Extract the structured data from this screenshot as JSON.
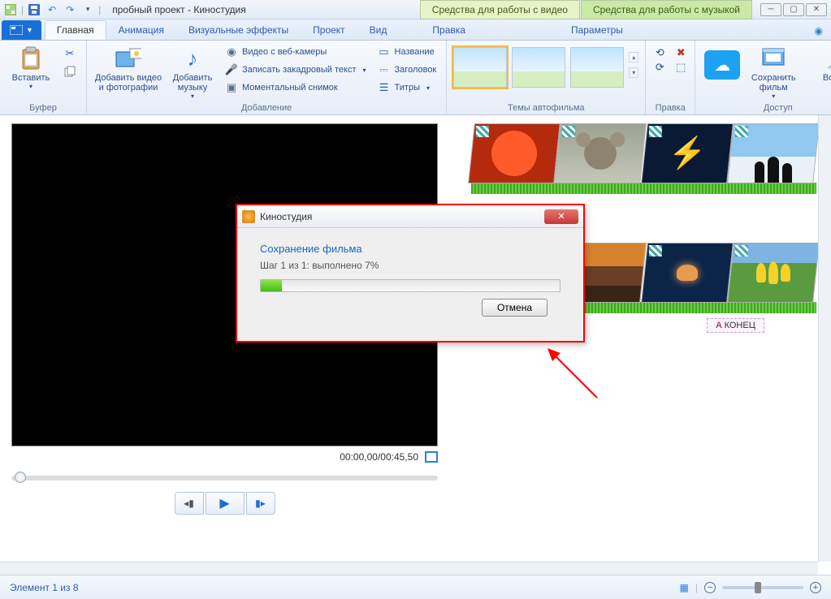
{
  "window": {
    "title": "пробный проект - Киностудия",
    "context_tab_video": "Средства для работы с видео",
    "context_tab_music": "Средства для работы с музыкой"
  },
  "tabs": {
    "file": "⧉",
    "home": "Главная",
    "animation": "Анимация",
    "effects": "Визуальные эффекты",
    "project": "Проект",
    "view": "Вид",
    "edit": "Правка",
    "params": "Параметры"
  },
  "ribbon": {
    "clipboard": {
      "paste": "Вставить",
      "group": "Буфер"
    },
    "add": {
      "video_photo": "Добавить видео и фотографии",
      "music": "Добавить музыку",
      "webcam": "Видео с веб-камеры",
      "narration": "Записать закадровый текст",
      "snapshot": "Моментальный снимок",
      "caption": "Название",
      "heading": "Заголовок",
      "titles": "Титры",
      "group": "Добавление"
    },
    "themes": {
      "group": "Темы автофильма"
    },
    "edit": {
      "group": "Правка"
    },
    "access": {
      "save": "Сохранить фильм",
      "signin": "Войти",
      "group": "Доступ"
    }
  },
  "preview": {
    "timecode": "00:00,00/00:45,50"
  },
  "storyboard": {
    "end_marker": "КОНЕЦ"
  },
  "dialog": {
    "title": "Киностудия",
    "heading": "Сохранение фильма",
    "step": "Шаг 1 из 1: выполнено 7%",
    "cancel": "Отмена",
    "progress_percent": 7
  },
  "statusbar": {
    "text": "Элемент 1 из 8"
  }
}
